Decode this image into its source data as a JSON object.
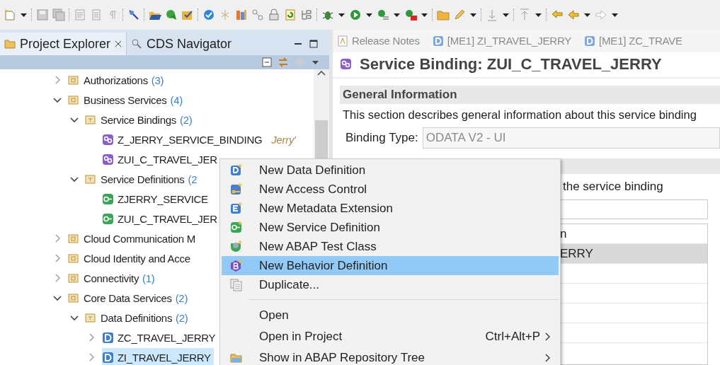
{
  "left_panel": {
    "tabs": [
      {
        "label": "Project Explorer",
        "selected": true,
        "closable": true
      },
      {
        "label": "CDS Navigator",
        "selected": false,
        "closable": false
      }
    ],
    "tree": [
      {
        "label": "Authorizations",
        "count": "(3)",
        "kind": "package",
        "expanded": false,
        "selected": false
      },
      {
        "label": "Business Services",
        "count": "(4)",
        "kind": "package",
        "expanded": true,
        "selected": false,
        "children": [
          {
            "label": "Service Bindings",
            "count": "(2)",
            "kind": "type",
            "expanded": true,
            "selected": false,
            "children": [
              {
                "label": "Z_JERRY_SERVICE_BINDING",
                "description": "Jerry'",
                "kind": "binding",
                "selected": false
              },
              {
                "label": "ZUI_C_TRAVEL_JER",
                "kind": "binding",
                "selected": false
              }
            ]
          },
          {
            "label": "Service Definitions",
            "count": "(2",
            "kind": "type",
            "expanded": true,
            "selected": false,
            "children": [
              {
                "label": "ZJERRY_SERVICE",
                "kind": "service",
                "selected": false
              },
              {
                "label": "ZUI_C_TRAVEL_JER",
                "kind": "service",
                "selected": false
              }
            ]
          }
        ]
      },
      {
        "label": "Cloud Communication M",
        "kind": "package",
        "expanded": false,
        "selected": false
      },
      {
        "label": "Cloud Identity and Acce",
        "kind": "package",
        "expanded": false,
        "selected": false
      },
      {
        "label": "Connectivity",
        "count": "(1)",
        "kind": "package",
        "expanded": false,
        "selected": false
      },
      {
        "label": "Core Data Services",
        "count": "(2)",
        "kind": "package",
        "expanded": true,
        "selected": false,
        "children": [
          {
            "label": "Data Definitions",
            "count": "(2)",
            "kind": "type",
            "expanded": true,
            "selected": false,
            "children": [
              {
                "label": "ZC_TRAVEL_JERRY",
                "kind": "ddl",
                "expanded": false,
                "selected": false
              },
              {
                "label": "ZI_TRAVEL_JERRY",
                "kind": "ddl",
                "expanded": false,
                "selected": true
              }
            ]
          }
        ]
      }
    ]
  },
  "editor": {
    "tabs": [
      {
        "label": "Release Notes",
        "kind": "notes",
        "selected": false
      },
      {
        "label": "[ME1] ZI_TRAVEL_JERRY",
        "kind": "ddl",
        "selected": false
      },
      {
        "label": "[ME1] ZC_TRAVE",
        "kind": "ddl",
        "selected": false
      }
    ],
    "title": "Service Binding: ZUI_C_TRAVEL_JERRY",
    "section": {
      "title": "General Information",
      "description": "This section describes general information about this service binding",
      "binding_type_label": "Binding Type:",
      "binding_type_value": "ODATA V2 - UI"
    },
    "section_2": {
      "description": "the service binding",
      "rows": [
        {
          "cell": "n",
          "selected": false
        },
        {
          "cell": "ERRY",
          "selected": true
        }
      ]
    }
  },
  "context_menu": {
    "items": [
      {
        "label": "New Data Definition",
        "kind": "definition",
        "selected": false,
        "separator_before": false
      },
      {
        "label": "New Access Control",
        "kind": "access",
        "selected": false,
        "separator_before": false
      },
      {
        "label": "New Metadata Extension",
        "kind": "extension",
        "selected": false,
        "separator_before": false
      },
      {
        "label": "New Service Definition",
        "kind": "service",
        "selected": false,
        "separator_before": false
      },
      {
        "label": "New ABAP Test Class",
        "kind": "test",
        "selected": false,
        "separator_before": false
      },
      {
        "label": "New Behavior Definition",
        "kind": "behavior",
        "selected": true,
        "separator_before": false
      },
      {
        "label": "Duplicate...",
        "kind": "duplicate",
        "selected": false,
        "separator_before": false
      },
      {
        "label": "Open",
        "selected": false,
        "separator_before": true
      },
      {
        "label": "Open in Project",
        "shortcut": "Ctrl+Alt+P",
        "submenu": true,
        "selected": false,
        "separator_before": false
      },
      {
        "label": "Show in ABAP Repository Tree",
        "kind": "repository",
        "submenu": true,
        "selected": false,
        "separator_before": false
      }
    ]
  }
}
